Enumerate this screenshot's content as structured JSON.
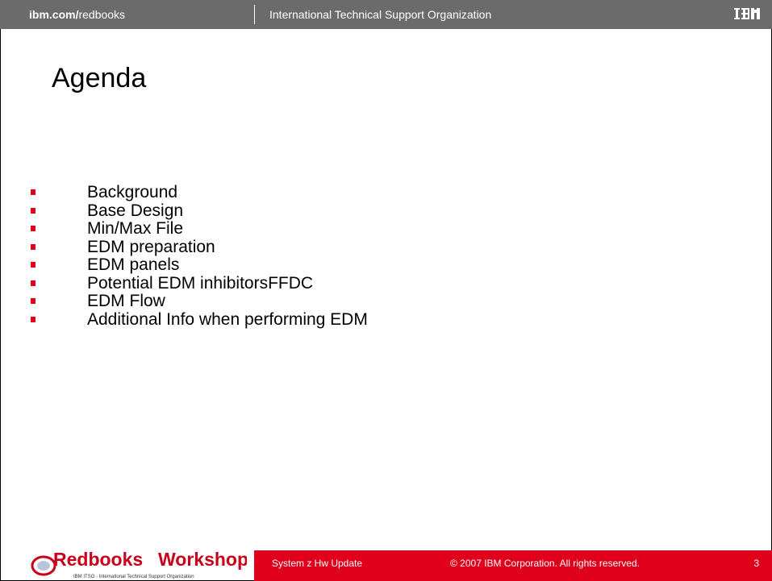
{
  "header": {
    "site_bold": "ibm.com/",
    "site_rest": "redbooks",
    "org": "International Technical Support Organization",
    "logo": "IBM"
  },
  "slide": {
    "title": "Agenda",
    "items": [
      "Background",
      "Base Design",
      "Min/Max File",
      "EDM preparation",
      "EDM panels",
      "Potential EDM inhibitorsFFDC",
      "EDM Flow",
      "Additional Info when performing EDM"
    ]
  },
  "footer": {
    "logo_text_1": "Redbooks",
    "logo_text_2": "Workshop",
    "logo_subtext": "IBM ITSO - International Technical Support Organization",
    "course": "System z Hw Update",
    "copyright": "© 2007 IBM Corporation. All rights reserved.",
    "page": "3"
  },
  "colors": {
    "header_bg": "#6b6b6b",
    "accent_red": "#e0001b"
  }
}
